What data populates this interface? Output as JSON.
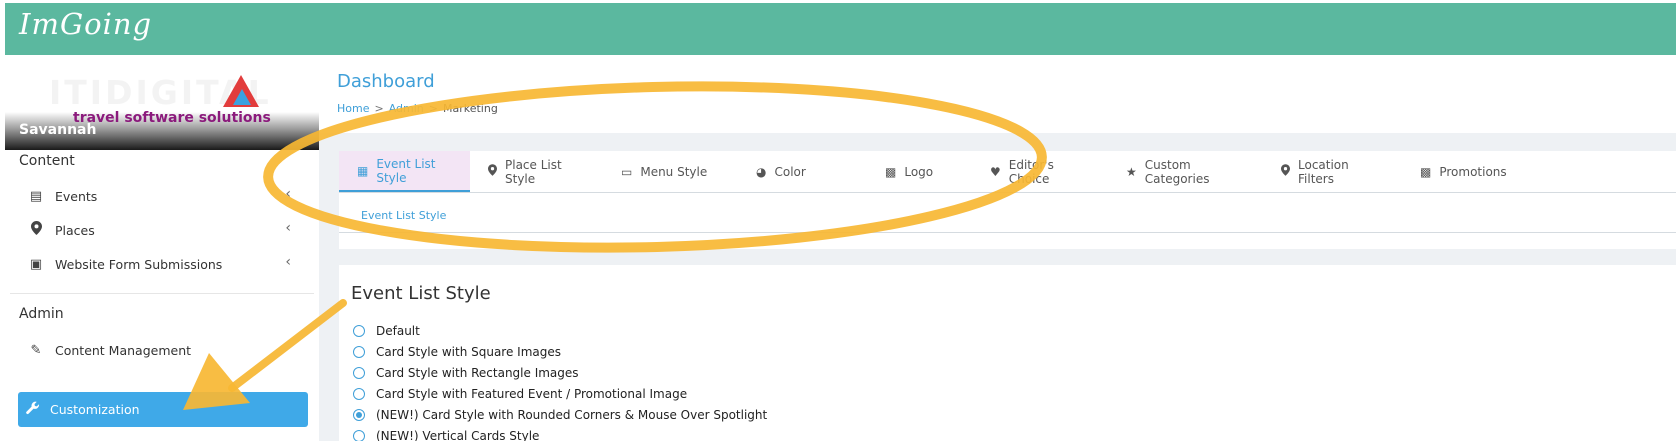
{
  "app": {
    "brand": "ImGoing"
  },
  "logo": {
    "text": "ITIDIGITAL",
    "tagline": "travel software solutions"
  },
  "user": {
    "name": "Savannah"
  },
  "sidebar": {
    "content_title": "Content",
    "content_items": [
      {
        "label": "Events",
        "icon": "list-icon"
      },
      {
        "label": "Places",
        "icon": "location-pin-icon"
      },
      {
        "label": "Website Form Submissions",
        "icon": "inbox-icon"
      }
    ],
    "admin_title": "Admin",
    "admin_items": [
      {
        "label": "Content Management",
        "icon": "pencil-icon"
      },
      {
        "label": "Customization",
        "icon": "wrench-icon",
        "active": true
      }
    ]
  },
  "header": {
    "title": "Dashboard",
    "breadcrumb": [
      "Home",
      "Admin",
      "Marketing"
    ]
  },
  "tabs": [
    {
      "label": "Event List Style",
      "icon": "calendar-icon",
      "active": true
    },
    {
      "label": "Place List Style",
      "icon": "location-pin-icon"
    },
    {
      "label": "Menu Style",
      "icon": "menu-card-icon"
    },
    {
      "label": "Color",
      "icon": "palette-icon"
    },
    {
      "label": "Logo",
      "icon": "image-icon"
    },
    {
      "label": "Editor's Choice",
      "icon": "heart-icon"
    },
    {
      "label": "Custom Categories",
      "icon": "star-icon"
    },
    {
      "label": "Location Filters",
      "icon": "location-pin-icon"
    },
    {
      "label": "Promotions",
      "icon": "image-icon"
    }
  ],
  "subtab": {
    "label": "Event List Style"
  },
  "card": {
    "title": "Event List Style",
    "options": [
      {
        "label": "Default",
        "checked": false
      },
      {
        "label": "Card Style with Square Images",
        "checked": false
      },
      {
        "label": "Card Style with Rectangle Images",
        "checked": false
      },
      {
        "label": "Card Style with Featured Event / Promotional Image",
        "checked": false
      },
      {
        "label": "(NEW!) Card Style with Rounded Corners & Mouse Over Spotlight",
        "checked": true
      },
      {
        "label": "(NEW!) Vertical Cards Style",
        "checked": false
      }
    ]
  },
  "colors": {
    "topbar": "#5bb89f",
    "accent": "#3f9fd8",
    "active_nav": "#3fa9e8",
    "annotation": "#f7b733"
  }
}
